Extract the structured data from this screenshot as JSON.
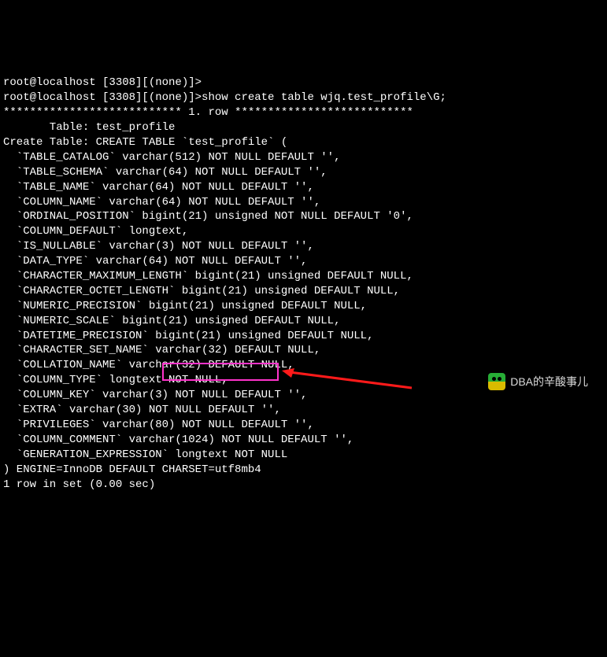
{
  "prompt1": "root@localhost [3308][(none)]>",
  "prompt2_line": "root@localhost [3308][(none)]>show create table wjq.test_profile\\G;",
  "separator": "*************************** 1. row ***************************",
  "table_line": "       Table: test_profile",
  "create_header": "Create Table: CREATE TABLE `test_profile` (",
  "cols": [
    "  `TABLE_CATALOG` varchar(512) NOT NULL DEFAULT '',",
    "  `TABLE_SCHEMA` varchar(64) NOT NULL DEFAULT '',",
    "  `TABLE_NAME` varchar(64) NOT NULL DEFAULT '',",
    "  `COLUMN_NAME` varchar(64) NOT NULL DEFAULT '',",
    "  `ORDINAL_POSITION` bigint(21) unsigned NOT NULL DEFAULT '0',",
    "  `COLUMN_DEFAULT` longtext,",
    "  `IS_NULLABLE` varchar(3) NOT NULL DEFAULT '',",
    "  `DATA_TYPE` varchar(64) NOT NULL DEFAULT '',",
    "  `CHARACTER_MAXIMUM_LENGTH` bigint(21) unsigned DEFAULT NULL,",
    "  `CHARACTER_OCTET_LENGTH` bigint(21) unsigned DEFAULT NULL,",
    "  `NUMERIC_PRECISION` bigint(21) unsigned DEFAULT NULL,",
    "  `NUMERIC_SCALE` bigint(21) unsigned DEFAULT NULL,",
    "  `DATETIME_PRECISION` bigint(21) unsigned DEFAULT NULL,",
    "  `CHARACTER_SET_NAME` varchar(32) DEFAULT NULL,",
    "  `COLLATION_NAME` varchar(32) DEFAULT NULL,",
    "  `COLUMN_TYPE` longtext NOT NULL,",
    "  `COLUMN_KEY` varchar(3) NOT NULL DEFAULT '',",
    "  `EXTRA` varchar(30) NOT NULL DEFAULT '',",
    "  `PRIVILEGES` varchar(80) NOT NULL DEFAULT '',",
    "  `COLUMN_COMMENT` varchar(1024) NOT NULL DEFAULT '',",
    "  `GENERATION_EXPRESSION` longtext NOT NULL"
  ],
  "engine_line": ") ENGINE=InnoDB DEFAULT CHARSET=utf8mb4",
  "result_line": "1 row in set (0.00 sec)",
  "watermark_text": "DBA的辛酸事儿",
  "highlighted_value": "CHARSET=utf8mb4"
}
